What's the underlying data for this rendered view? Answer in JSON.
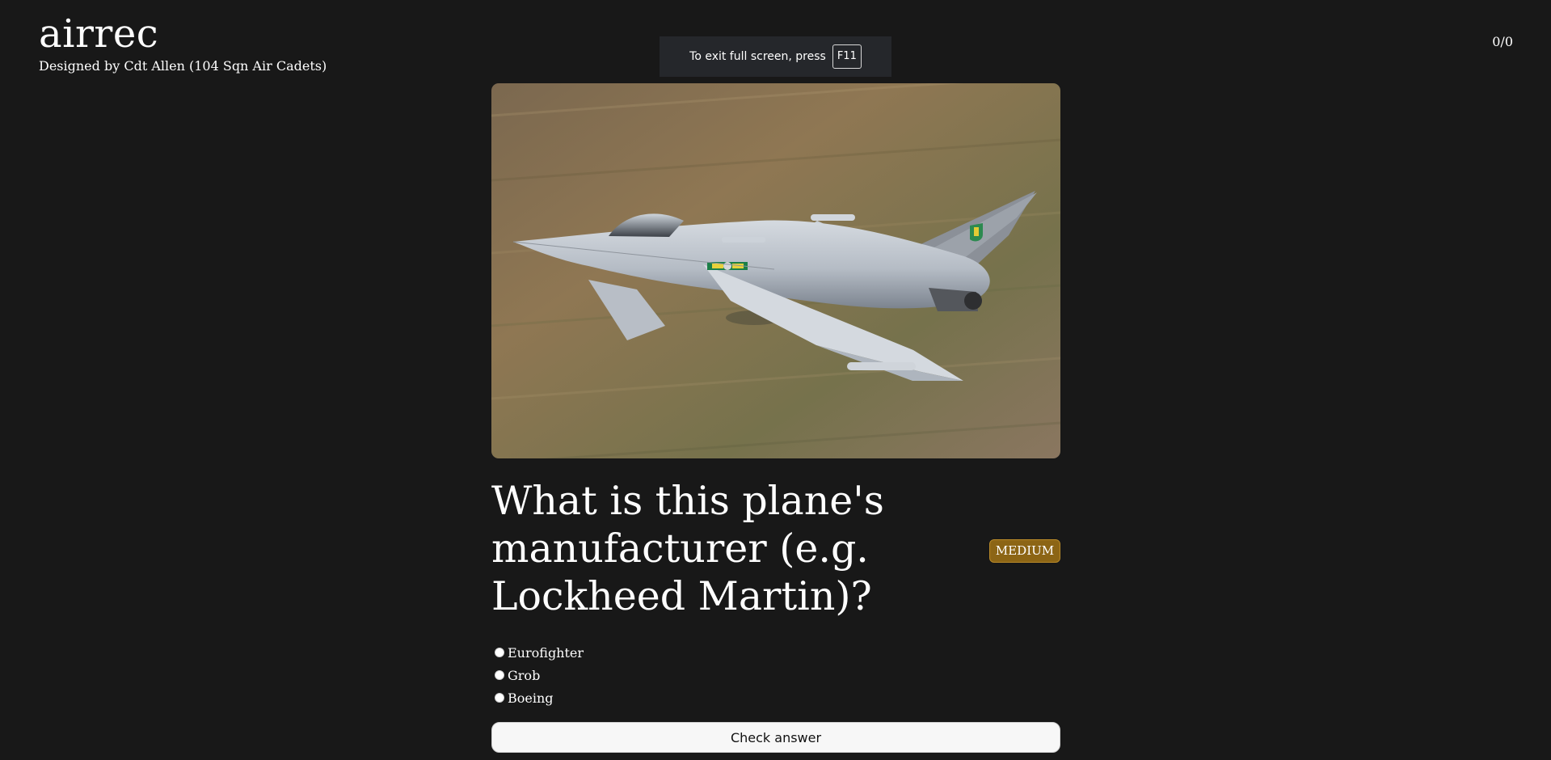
{
  "header": {
    "app_title": "airrec",
    "subtitle": "Designed by Cdt Allen (104 Sqn Air Cadets)",
    "score": "0/0"
  },
  "toast": {
    "prefix": "To exit full screen, press",
    "key": "F11"
  },
  "quiz": {
    "question": "What is this plane's manufacturer (e.g. Lockheed Martin)?",
    "difficulty": "MEDIUM",
    "options": [
      {
        "label": "Eurofighter"
      },
      {
        "label": "Grob"
      },
      {
        "label": "Boeing"
      }
    ],
    "check_label": "Check answer"
  },
  "colors": {
    "background": "#181818",
    "badge_background": "#8c6515",
    "button_background": "#f7f7f7"
  },
  "icons": {
    "photo": "plane-photo"
  }
}
